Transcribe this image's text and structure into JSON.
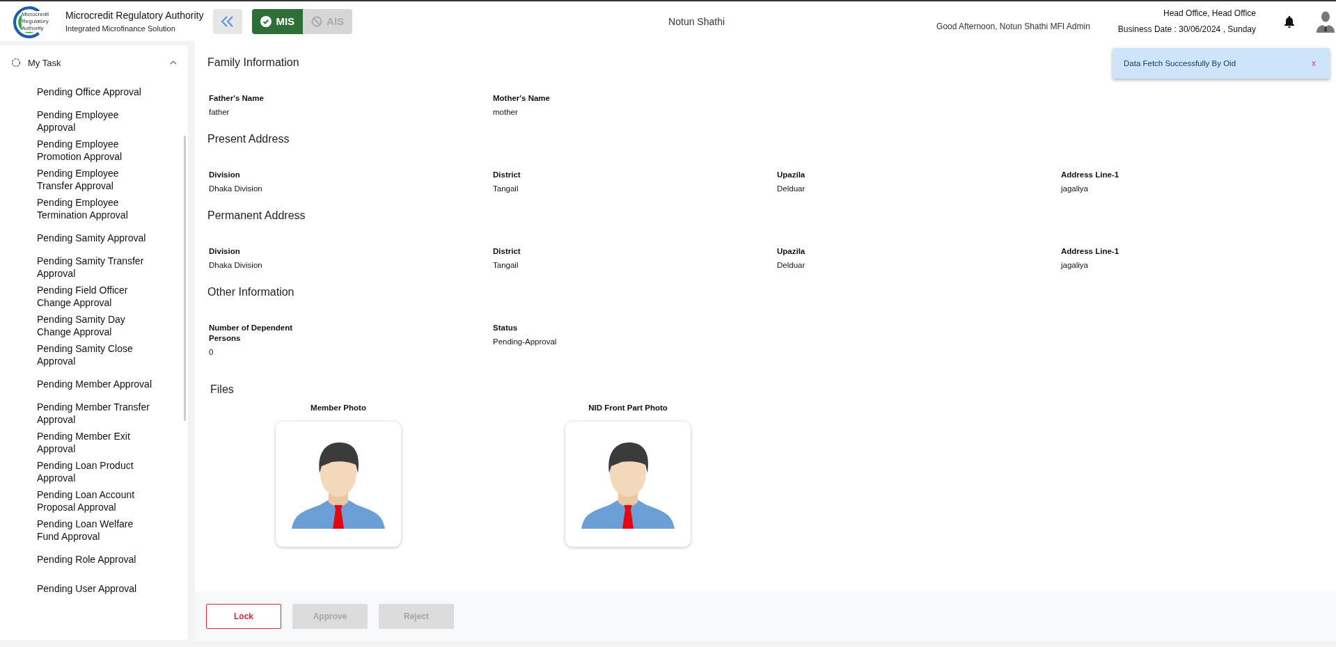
{
  "header": {
    "logo_text": "Microcredit Regulatory Authority",
    "org_name": "Microcredit Regulatory Authority",
    "org_subtitle": "Integrated Microfinance Solution",
    "modules": [
      {
        "label": "MIS",
        "selected": true
      },
      {
        "label": "AIS",
        "selected": false
      }
    ],
    "mfi_name": "Notun Shathi",
    "greeting": "Good Afternoon, Notun Shathi MFI Admin",
    "office": "Head Office, Head Office",
    "business_date": "Business Date : 30/06/2024 , Sunday"
  },
  "sidebar": {
    "group": {
      "label": "My Task",
      "expanded": true
    },
    "items": [
      "Pending Office Approval",
      "Pending Employee Approval",
      "Pending Employee Promotion Approval",
      "Pending Employee Transfer Approval",
      "Pending Employee Termination Approval",
      "Pending Samity Approval",
      "Pending Samity Transfer Approval",
      "Pending Field Officer Change Approval",
      "Pending Samity Day Change Approval",
      "Pending Samity Close Approval",
      "Pending Member Approval",
      "Pending Member Transfer Approval",
      "Pending Member Exit Approval",
      "Pending Loan Product Approval",
      "Pending Loan Account Proposal Approval",
      "Pending Loan Welfare Fund Approval",
      "Pending Role Approval",
      "Pending User Approval"
    ]
  },
  "sections": [
    {
      "title": "Family Information",
      "fields": [
        {
          "label": "Father's Name",
          "value": "father"
        },
        {
          "label": "Mother's Name",
          "value": "mother"
        }
      ]
    },
    {
      "title": "Present Address",
      "fields": [
        {
          "label": "Division",
          "value": "Dhaka Division"
        },
        {
          "label": "District",
          "value": "Tangail"
        },
        {
          "label": "Upazila",
          "value": "Delduar"
        },
        {
          "label": "Address Line-1",
          "value": "jagaliya"
        }
      ]
    },
    {
      "title": "Permanent Address",
      "fields": [
        {
          "label": "Division",
          "value": "Dhaka Division"
        },
        {
          "label": "District",
          "value": "Tangail"
        },
        {
          "label": "Upazila",
          "value": "Delduar"
        },
        {
          "label": "Address Line-1",
          "value": "jagaliya"
        }
      ]
    },
    {
      "title": "Other Information",
      "fields": [
        {
          "label": "Number of Dependent Persons",
          "value": "0"
        },
        {
          "label": "Status",
          "value": "Pending-Approval"
        }
      ]
    }
  ],
  "files": {
    "title": "Files",
    "items": [
      {
        "label": "Member Photo"
      },
      {
        "label": "NID Front Part Photo"
      }
    ]
  },
  "actions": [
    {
      "label": "Lock",
      "disabled": false
    },
    {
      "label": "Approve",
      "disabled": true
    },
    {
      "label": "Reject",
      "disabled": true
    }
  ],
  "toast": {
    "message": "Data Fetch Successfully By Oid",
    "close": "x"
  }
}
